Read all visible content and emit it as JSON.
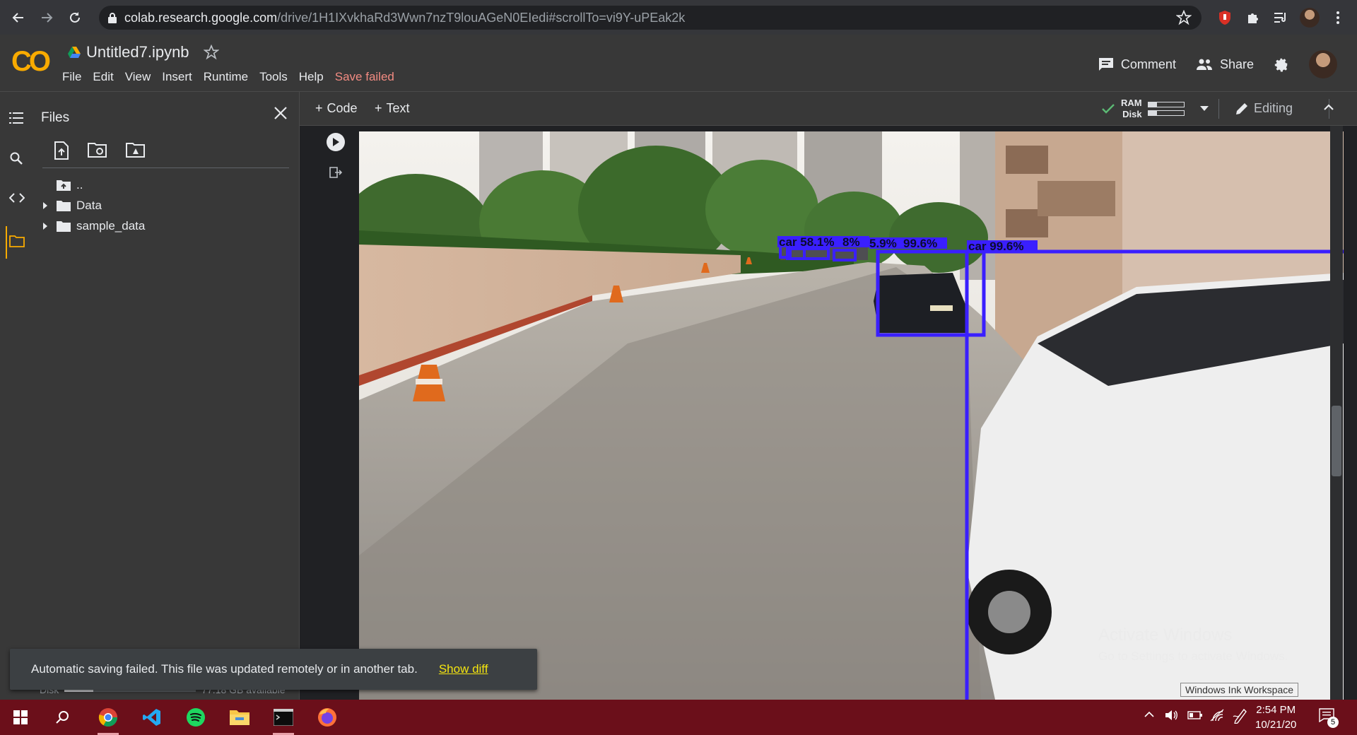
{
  "browser": {
    "url_host": "colab.research.google.com",
    "url_path": "/drive/1H1IXvkhaRd3Wwn7nzT9louAGeN0EIedi#scrollTo=vi9Y-uPEak2k"
  },
  "header": {
    "logo": "CO",
    "notebook_title": "Untitled7.ipynb",
    "menu": [
      "File",
      "Edit",
      "View",
      "Insert",
      "Runtime",
      "Tools",
      "Help"
    ],
    "save_status": "Save failed",
    "comment_label": "Comment",
    "share_label": "Share"
  },
  "files_panel": {
    "title": "Files",
    "tree": [
      {
        "label": ".."
      },
      {
        "label": "Data"
      },
      {
        "label": "sample_data"
      }
    ],
    "disk_label": "Disk",
    "disk_available": "77.18 GB available",
    "disk_used_fraction": 0.22
  },
  "toolbar": {
    "add_code": "Code",
    "add_text": "Text",
    "ram_label": "RAM",
    "disk_label": "Disk",
    "ram_fraction": 0.25,
    "disk_fraction": 0.25,
    "editing_label": "Editing"
  },
  "output": {
    "detections": [
      {
        "label": "car 58.1%"
      },
      {
        "label": "8%"
      },
      {
        "label": "5.9%"
      },
      {
        "label": "99.6%"
      },
      {
        "label": "car 99.6%"
      }
    ],
    "box_color": "#3a1fff"
  },
  "watermark": {
    "line1": "Activate Windows",
    "line2": "Go to Settings to activate Windows."
  },
  "ink_tooltip": "Windows Ink Workspace",
  "snackbar": {
    "message": "Automatic saving failed. This file was updated remotely or in another tab.",
    "action": "Show diff"
  },
  "taskbar": {
    "time": "2:54 PM",
    "date": "10/21/20",
    "notification_count": "5"
  },
  "colors": {
    "accent": "#f9ab00",
    "error": "#f28b82",
    "taskbar": "#6b0f1a",
    "link": "#f4e40f"
  }
}
